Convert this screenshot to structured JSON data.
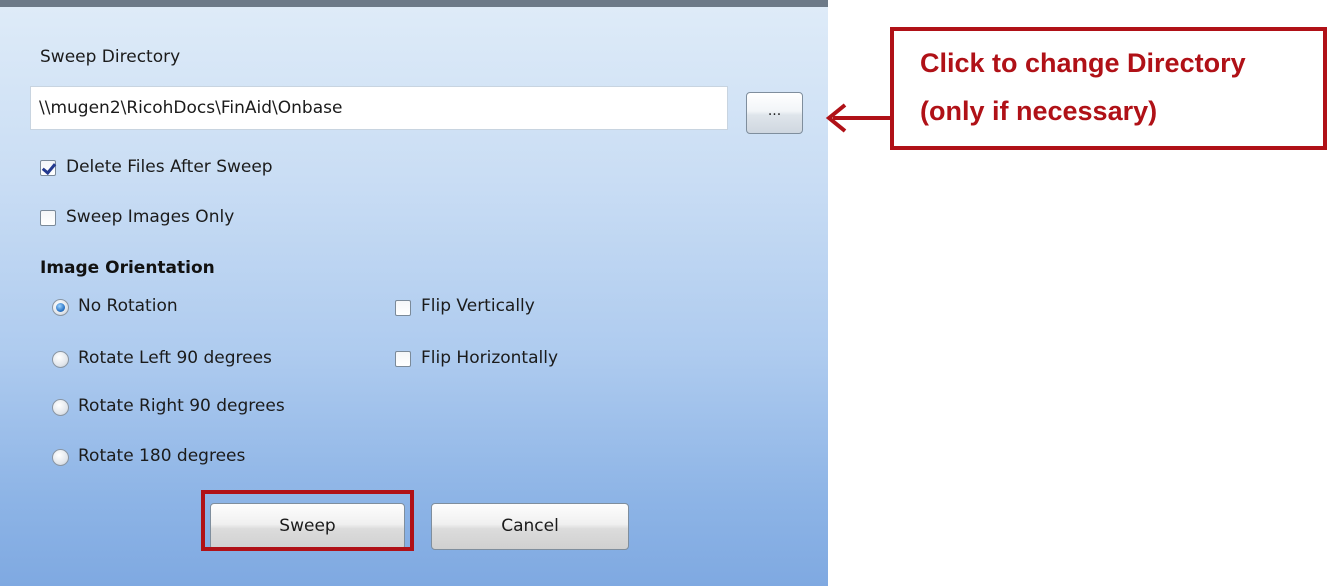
{
  "dialog": {
    "sweep_directory_label": "Sweep Directory",
    "sweep_directory_value": "\\\\mugen2\\RicohDocs\\FinAid\\Onbase",
    "browse_button_label": "...",
    "options": {
      "delete_files_after_sweep": {
        "label": "Delete Files After Sweep",
        "checked": true
      },
      "sweep_images_only": {
        "label": "Sweep Images Only",
        "checked": false
      }
    },
    "image_orientation": {
      "title": "Image Orientation",
      "rotation_options": [
        {
          "label": "No Rotation",
          "selected": true
        },
        {
          "label": "Rotate Left 90 degrees",
          "selected": false
        },
        {
          "label": "Rotate Right 90 degrees",
          "selected": false
        },
        {
          "label": "Rotate 180 degrees",
          "selected": false
        }
      ],
      "flip_options": [
        {
          "label": "Flip Vertically",
          "checked": false
        },
        {
          "label": "Flip Horizontally",
          "checked": false
        }
      ]
    },
    "sweep_button_label": "Sweep",
    "cancel_button_label": "Cancel"
  },
  "annotation": {
    "callout_line1": "Click to change Directory",
    "callout_line2": "(only if necessary)",
    "color": "#b01117"
  },
  "colors": {
    "dialog_gradient_top": "#deebf8",
    "dialog_gradient_bottom": "#7fa9e1",
    "title_bar": "#6d7a88"
  }
}
